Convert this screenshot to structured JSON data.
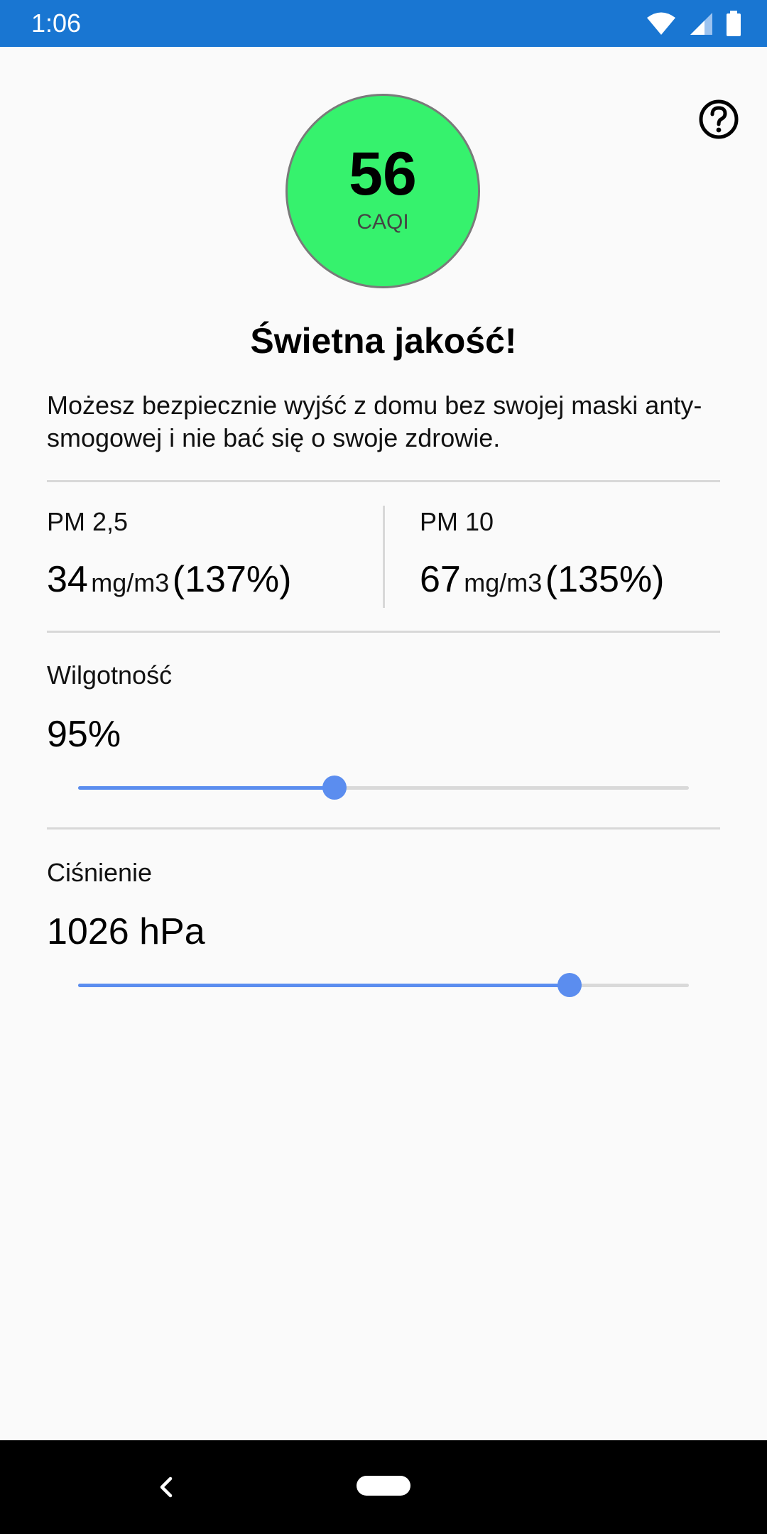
{
  "status_bar": {
    "time": "1:06",
    "icons": [
      "wifi-icon",
      "signal-icon",
      "battery-icon"
    ]
  },
  "help": {
    "icon": "help-circle-icon"
  },
  "aqi": {
    "value": "56",
    "unit": "CAQI",
    "color": "#36f26d"
  },
  "quality": {
    "title": "Świetna jakość!",
    "description": "Możesz bezpiecznie wyjść z domu bez swojej maski anty-smogowej i nie bać się o swoje zdrowie."
  },
  "pm25": {
    "label": "PM 2,5",
    "value": "34",
    "unit": "mg/m3",
    "percent": "(137%)"
  },
  "pm10": {
    "label": "PM 10",
    "value": "67",
    "unit": "mg/m3",
    "percent": "(135%)"
  },
  "humidity": {
    "label": "Wilgotność",
    "value": "95%",
    "slider_fraction": 0.42
  },
  "pressure": {
    "label": "Ciśnienie",
    "value": "1026 hPa",
    "slider_fraction": 0.805
  },
  "accent_color": "#5b8def",
  "nav": {
    "back_icon": "back-chevron-icon",
    "home_icon": "home-pill-icon"
  }
}
